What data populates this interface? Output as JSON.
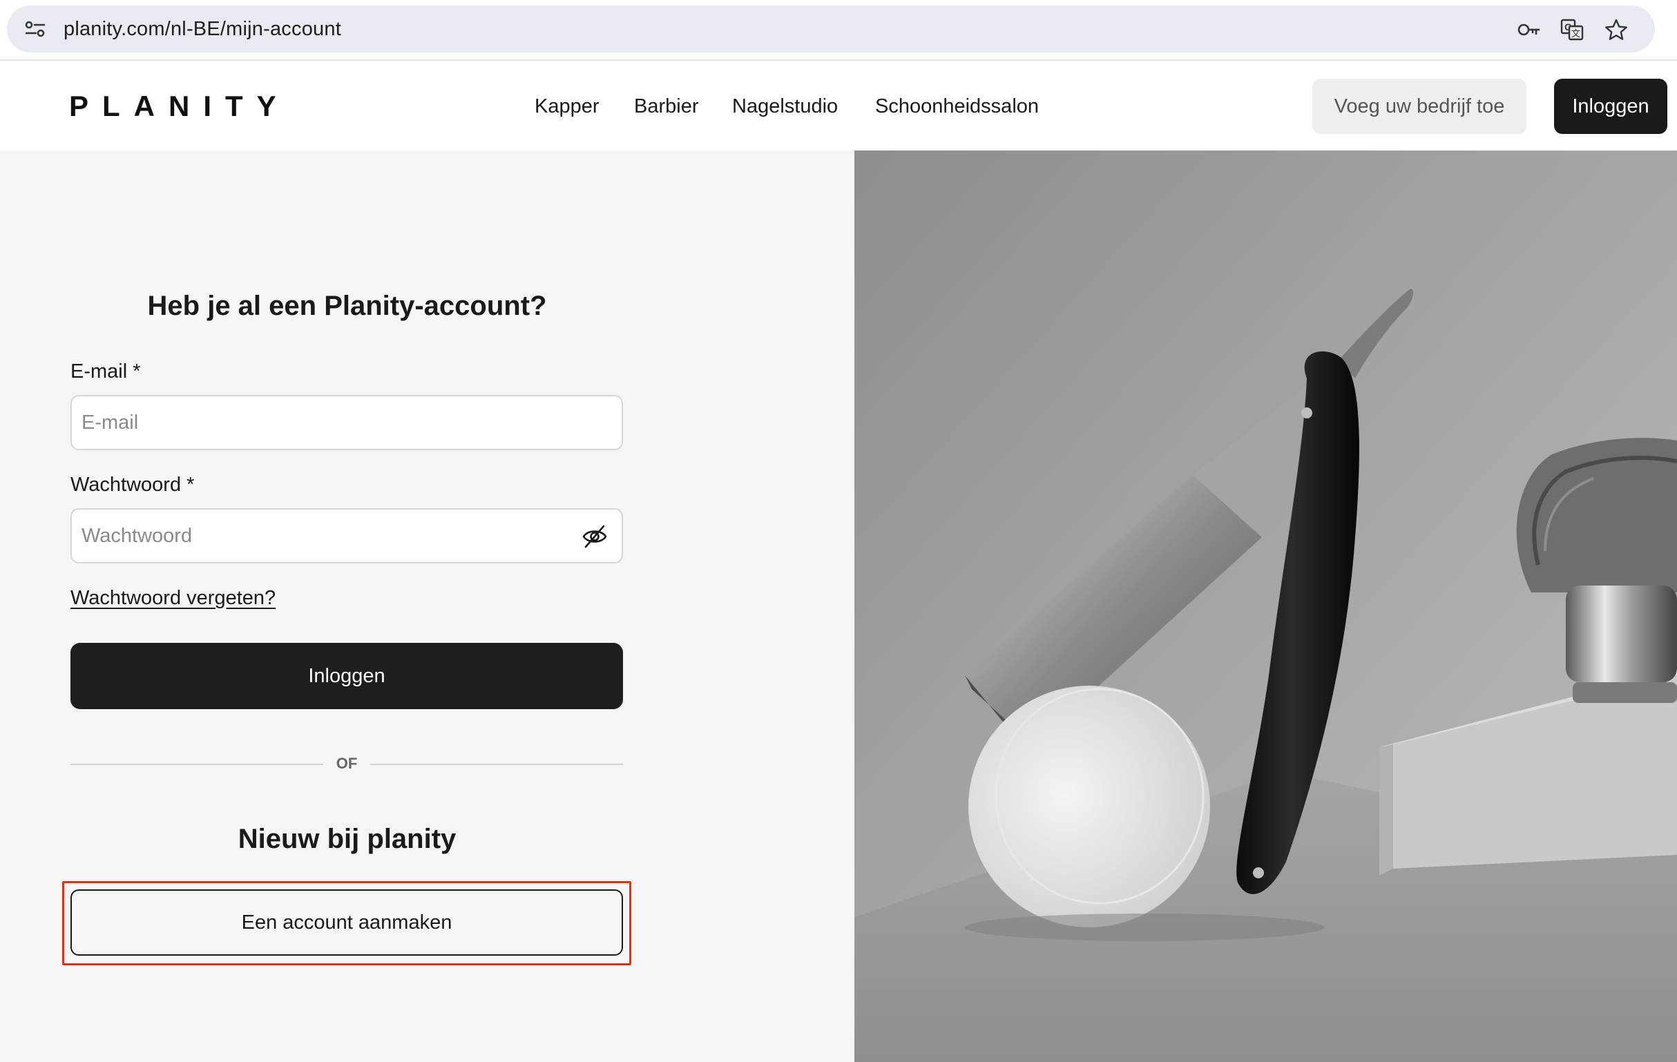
{
  "browser": {
    "url": "planity.com/nl-BE/mijn-account",
    "icons": [
      "site-info-icon",
      "password-key-icon",
      "translate-icon",
      "bookmark-star-icon"
    ]
  },
  "header": {
    "logo": "PLANITY",
    "nav": [
      {
        "label": "Kapper"
      },
      {
        "label": "Barbier"
      },
      {
        "label": "Nagelstudio"
      },
      {
        "label": "Schoonheidssalon"
      }
    ],
    "add_business": "Voeg uw bedrijf toe",
    "login": "Inloggen"
  },
  "login_form": {
    "title": "Heb je al een Planity-account?",
    "email_label": "E-mail *",
    "email_placeholder": "E-mail",
    "email_value": "",
    "password_label": "Wachtwoord *",
    "password_placeholder": "Wachtwoord",
    "password_value": "",
    "forgot_password": "Wachtwoord vergeten?",
    "submit": "Inloggen",
    "divider": "OF"
  },
  "signup": {
    "title": "Nieuw bij planity",
    "create_account": "Een account aanmaken"
  },
  "colors": {
    "primary_dark": "#1e1e1e",
    "panel_bg": "#f5f5f5",
    "highlight": "#e0301e"
  }
}
